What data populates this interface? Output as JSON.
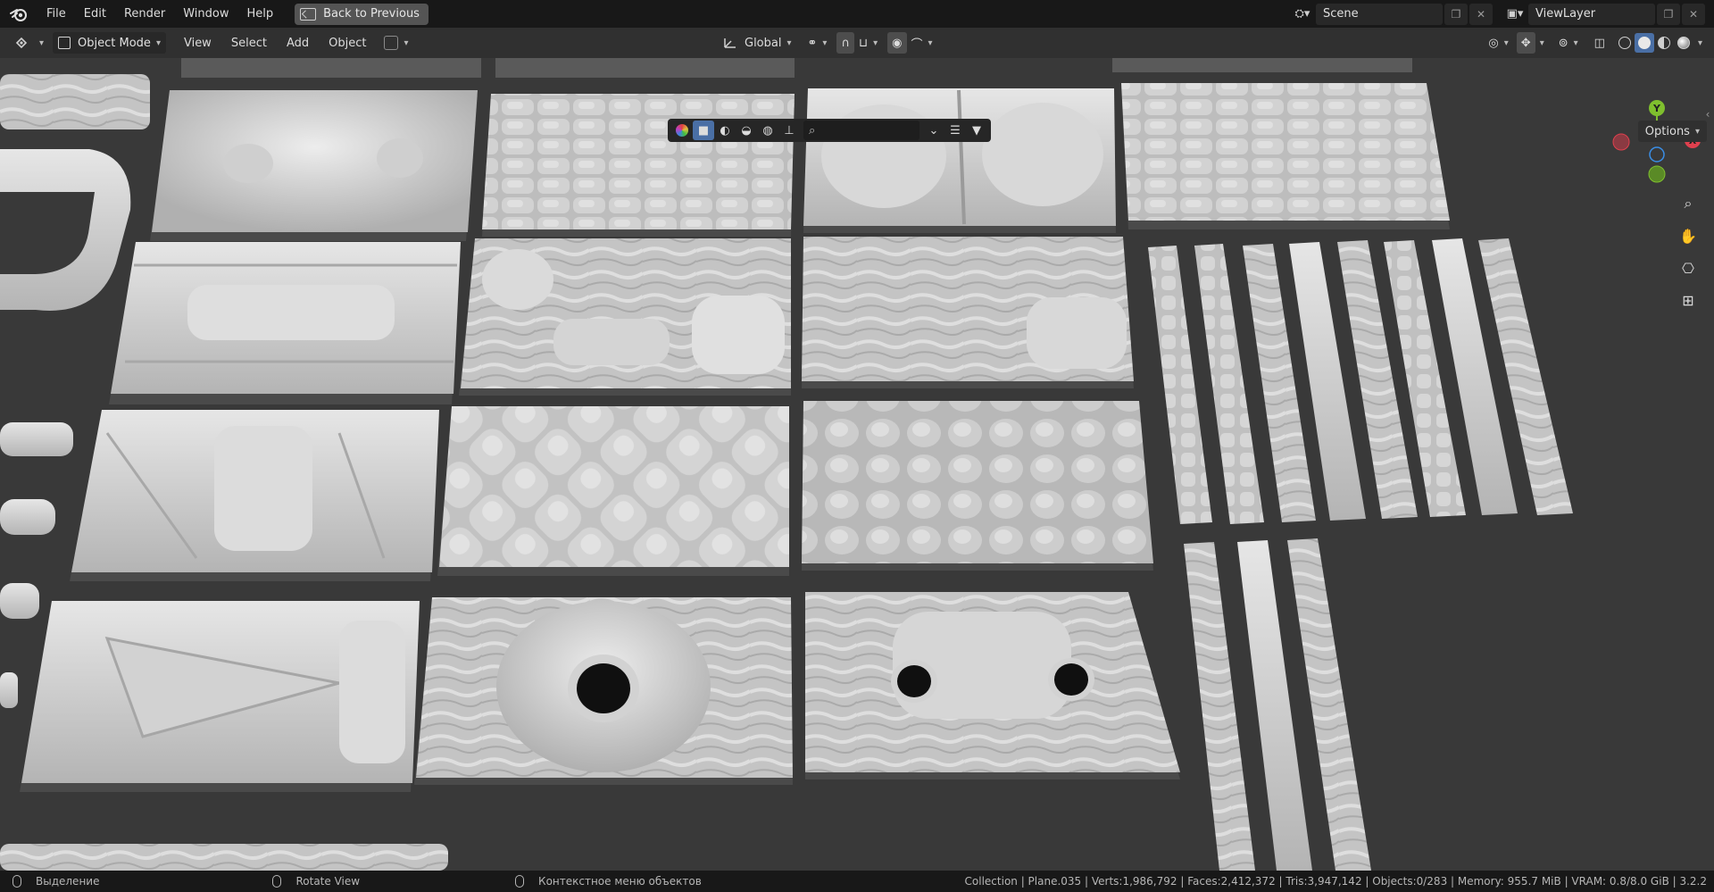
{
  "menubar": {
    "items": [
      "File",
      "Edit",
      "Render",
      "Window",
      "Help"
    ],
    "back_button": "Back to Previous",
    "scene_name": "Scene",
    "view_layer": "ViewLayer"
  },
  "header": {
    "mode": "Object Mode",
    "menus": [
      "View",
      "Select",
      "Add",
      "Object"
    ],
    "transform_orientation": "Global"
  },
  "viewport": {
    "options_label": "Options",
    "gizmo_axes": {
      "x": "X",
      "y": "Y",
      "z": "Z"
    },
    "colors": {
      "x_axis": "#e0404e",
      "y_axis": "#7fbf2e",
      "z_axis": "#3a8ee6",
      "background": "#393939",
      "mesh": "#c8c8c8"
    }
  },
  "statusbar": {
    "left_action": "Выделение",
    "middle_action": "Rotate View",
    "right_action": "Контекстное меню объектов",
    "stats": "Collection | Plane.035 | Verts:1,986,792 | Faces:2,412,372 | Tris:3,947,142 | Objects:0/283 | Memory: 955.7 MiB | VRAM: 0.8/8.0 GiB | 3.2.2"
  }
}
